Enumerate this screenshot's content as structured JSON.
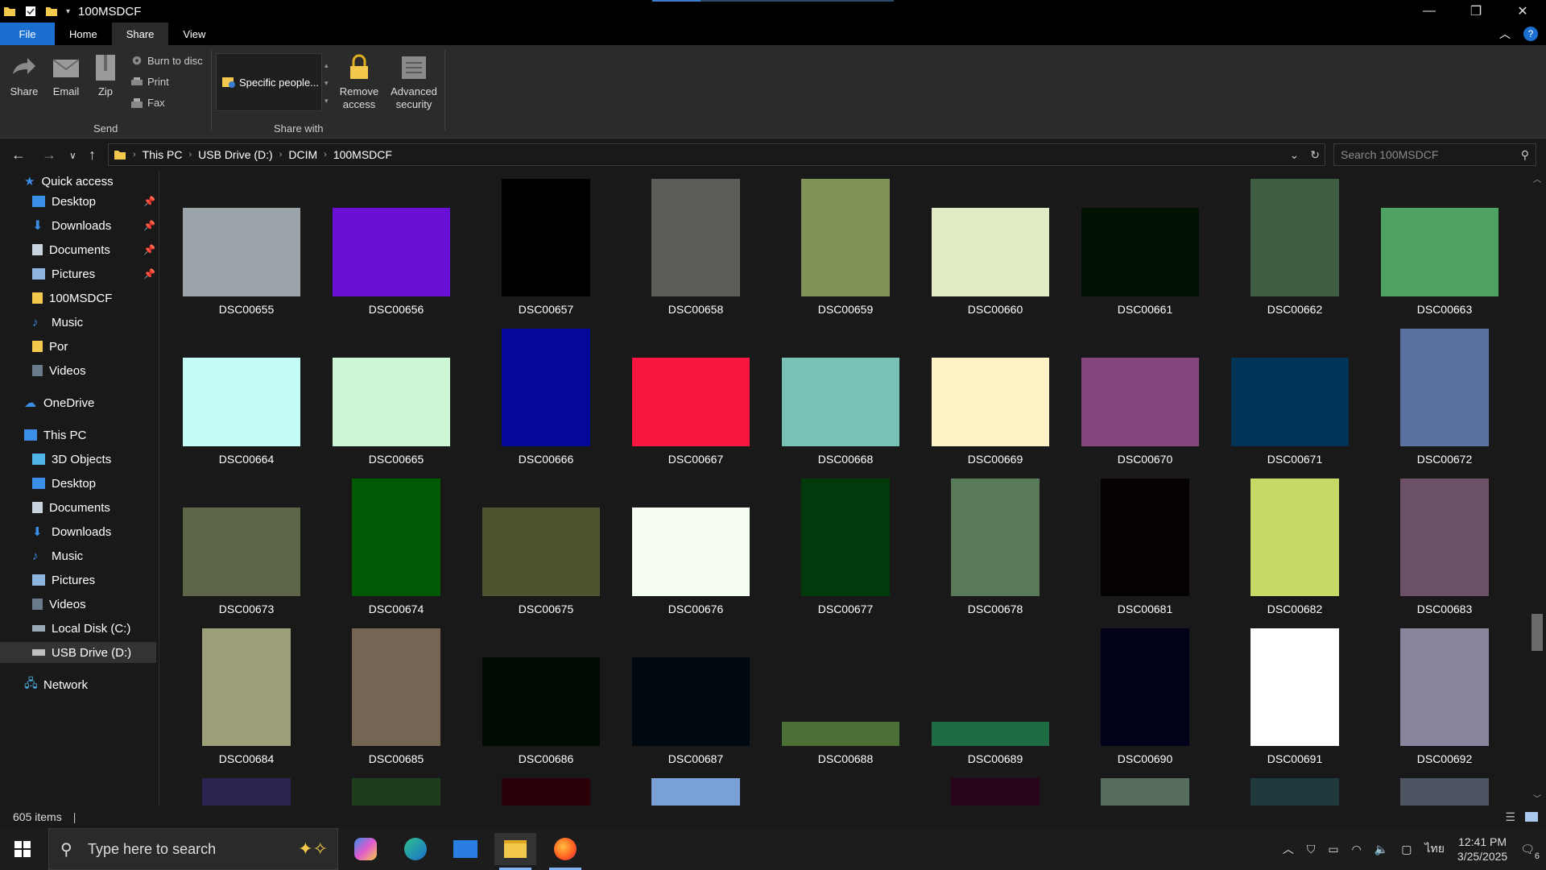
{
  "window": {
    "title": "100MSDCF"
  },
  "tabs": [
    {
      "label": "File"
    },
    {
      "label": "Home"
    },
    {
      "label": "Share"
    },
    {
      "label": "View"
    }
  ],
  "ribbon": {
    "share_label": "Share",
    "email_label": "Email",
    "zip_label": "Zip",
    "burn_label": "Burn to disc",
    "print_label": "Print",
    "fax_label": "Fax",
    "send_group": "Send",
    "specific_people": "Specific people...",
    "remove_access_1": "Remove",
    "remove_access_2": "access",
    "advanced_security_1": "Advanced",
    "advanced_security_2": "security",
    "share_with_group": "Share with"
  },
  "address": {
    "crumbs": [
      "This PC",
      "USB Drive (D:)",
      "DCIM",
      "100MSDCF"
    ],
    "search_placeholder": "Search 100MSDCF"
  },
  "sidebar": {
    "quick_access": "Quick access",
    "quick_items": [
      "Desktop",
      "Downloads",
      "Documents",
      "Pictures",
      "100MSDCF",
      "Music",
      "Por",
      "Videos"
    ],
    "onedrive": "OneDrive",
    "this_pc": "This PC",
    "pc_items": [
      "3D Objects",
      "Desktop",
      "Documents",
      "Downloads",
      "Music",
      "Pictures",
      "Videos",
      "Local Disk (C:)",
      "USB Drive (D:)"
    ],
    "network": "Network"
  },
  "files": [
    {
      "name": "DSC00655",
      "color": "#9aa3a8"
    },
    {
      "name": "DSC00656",
      "color": "#6a0fd6"
    },
    {
      "name": "DSC00657",
      "color": "#000000"
    },
    {
      "name": "DSC00658",
      "color": "#5d5c56"
    },
    {
      "name": "DSC00659",
      "color": "#7f9358"
    },
    {
      "name": "DSC00660",
      "color": "#e1ecc6"
    },
    {
      "name": "DSC00661",
      "color": "#021202"
    },
    {
      "name": "DSC00662",
      "color": "#3e5e44"
    },
    {
      "name": "DSC00663",
      "color": "#4ea364"
    },
    {
      "name": "DSC00664",
      "color": "#c4fbf6"
    },
    {
      "name": "DSC00665",
      "color": "#ccf7d6"
    },
    {
      "name": "DSC00666",
      "color": "#040899"
    },
    {
      "name": "DSC00667",
      "color": "#fb1641"
    },
    {
      "name": "DSC00668",
      "color": "#79c3b6"
    },
    {
      "name": "DSC00669",
      "color": "#fef2c7"
    },
    {
      "name": "DSC00670",
      "color": "#82457e"
    },
    {
      "name": "DSC00671",
      "color": "#003456"
    },
    {
      "name": "DSC00672",
      "color": "#5a71a2"
    },
    {
      "name": "DSC00673",
      "color": "#5d6649"
    },
    {
      "name": "DSC00674",
      "color": "#005a03"
    },
    {
      "name": "DSC00675",
      "color": "#4e5430"
    },
    {
      "name": "DSC00676",
      "color": "#f6fdf2"
    },
    {
      "name": "DSC00677",
      "color": "#013a0b"
    },
    {
      "name": "DSC00678",
      "color": "#587a58"
    },
    {
      "name": "DSC00681",
      "color": "#060102"
    },
    {
      "name": "DSC00682",
      "color": "#c9d966"
    },
    {
      "name": "DSC00683",
      "color": "#6b5068"
    },
    {
      "name": "DSC00684",
      "color": "#9c9f78"
    },
    {
      "name": "DSC00685",
      "color": "#756653"
    },
    {
      "name": "DSC00686",
      "color": "#000c02"
    },
    {
      "name": "DSC00687",
      "color": "#010910"
    },
    {
      "name": "DSC00688",
      "color": "#4a6e34"
    },
    {
      "name": "DSC00689",
      "color": "#1f6b43"
    },
    {
      "name": "DSC00690",
      "color": "#01021a"
    },
    {
      "name": "DSC00691",
      "color": "#ffffff"
    },
    {
      "name": "DSC00692",
      "color": "#8a849c"
    }
  ],
  "peek_colors": [
    "#2a2450",
    "#1e3d1c",
    "#2a0108",
    "#7aa0d8",
    "#26051a",
    "#566c5c",
    "#1e3a3c",
    "#4e5562"
  ],
  "status": {
    "items": "605 items"
  },
  "taskbar": {
    "search_placeholder": "Type here to search",
    "time": "12:41 PM",
    "date": "3/25/2025",
    "lang": "ไทย",
    "notifications": "6"
  }
}
